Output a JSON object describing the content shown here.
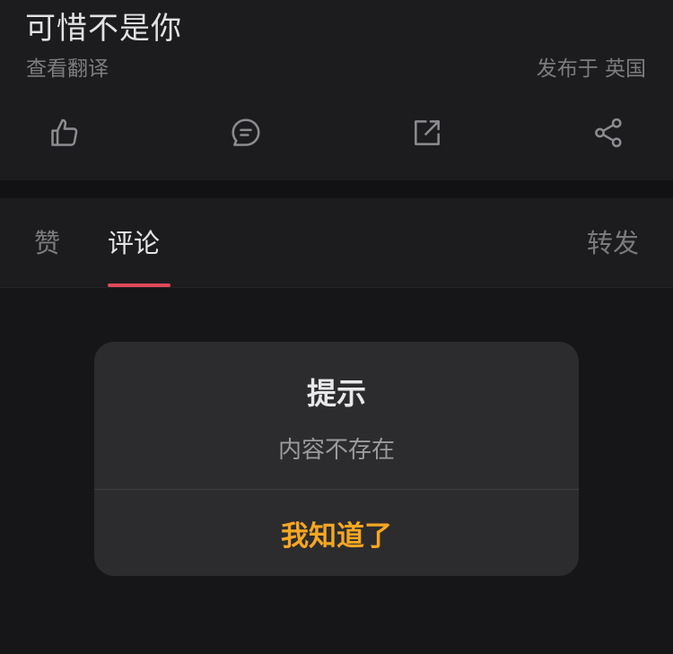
{
  "post": {
    "text": "可惜不是你",
    "translate_label": "查看翻译",
    "published_label": "发布于 英国"
  },
  "actions": [
    {
      "icon": "thumbs-up-icon"
    },
    {
      "icon": "comment-icon"
    },
    {
      "icon": "external-link-icon"
    },
    {
      "icon": "share-icon"
    }
  ],
  "tabs": {
    "like_label": "赞",
    "comment_label": "评论",
    "forward_label": "转发",
    "active": "评论"
  },
  "dialog": {
    "title": "提示",
    "message": "内容不存在",
    "button_label": "我知道了"
  },
  "colors": {
    "background": "#161618",
    "panel": "#1c1c1e",
    "dialog": "#2c2c2e",
    "tab_indicator": "#e0485a",
    "button_accent": "#f5a623"
  }
}
